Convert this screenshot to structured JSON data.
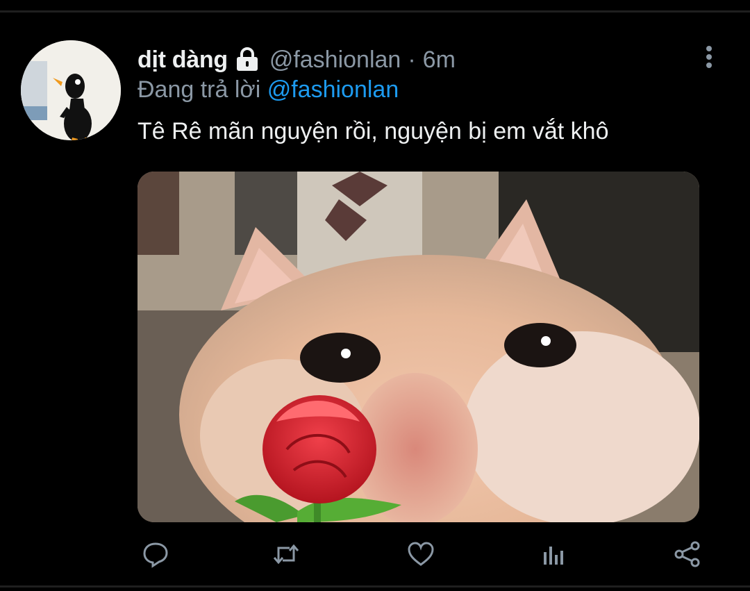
{
  "tweet": {
    "display_name": "dịt dàng",
    "handle": "@fashionlan",
    "separator": "·",
    "time": "6m",
    "replying_prefix": "Đang trả lời",
    "replying_mention": "@fashionlan",
    "text": "Tê Rê mãn nguyện rồi, nguyện bị em vắt khô"
  },
  "colors": {
    "background": "#000000",
    "primary_text": "#eef0f1",
    "secondary_text": "#8b98a5",
    "mention": "#1d9bf0"
  },
  "icons": {
    "lock": "lock-icon",
    "more": "more-vertical-icon",
    "reply": "reply-icon",
    "retweet": "retweet-icon",
    "like": "heart-icon",
    "analytics": "analytics-icon",
    "share": "share-icon"
  }
}
